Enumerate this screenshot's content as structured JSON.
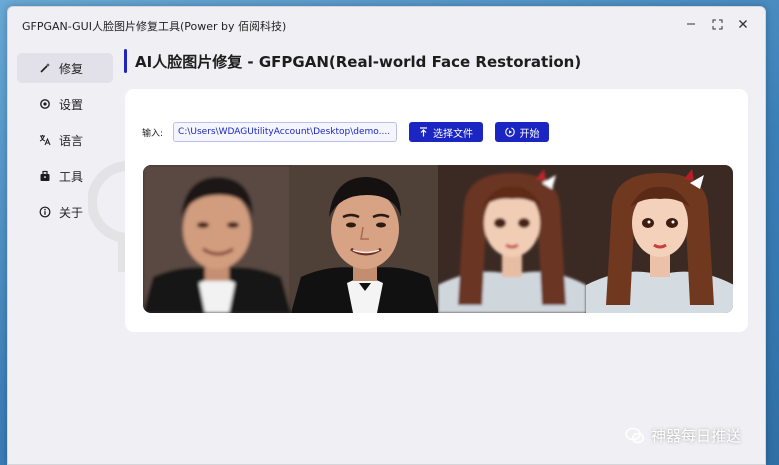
{
  "window": {
    "title": "GFPGAN-GUI人脸图片修复工具(Power by 佰阅科技)"
  },
  "sidebar": {
    "items": [
      {
        "label": "修复",
        "icon": "magic-wand-icon",
        "active": true
      },
      {
        "label": "设置",
        "icon": "settings-icon",
        "active": false
      },
      {
        "label": "语言",
        "icon": "language-icon",
        "active": false
      },
      {
        "label": "工具",
        "icon": "toolbox-icon",
        "active": false
      },
      {
        "label": "关于",
        "icon": "info-icon",
        "active": false
      }
    ]
  },
  "main": {
    "title": "AI人脸图片修复 - GFPGAN(Real-world Face Restoration)",
    "input_label": "输入:",
    "input_value": "C:\\Users\\WDAGUtilityAccount\\Desktop\\demo....",
    "select_file_label": "选择文件",
    "start_label": "开始"
  },
  "preview": {
    "images": [
      {
        "name": "man-face-original"
      },
      {
        "name": "man-face-restored"
      },
      {
        "name": "illustrated-woman-original"
      },
      {
        "name": "illustrated-woman-restored"
      }
    ]
  },
  "watermark": {
    "text": "神器每日推送"
  },
  "colors": {
    "accent": "#1b26c2",
    "window_bg": "#f0eff3",
    "card_bg": "#ffffff"
  }
}
